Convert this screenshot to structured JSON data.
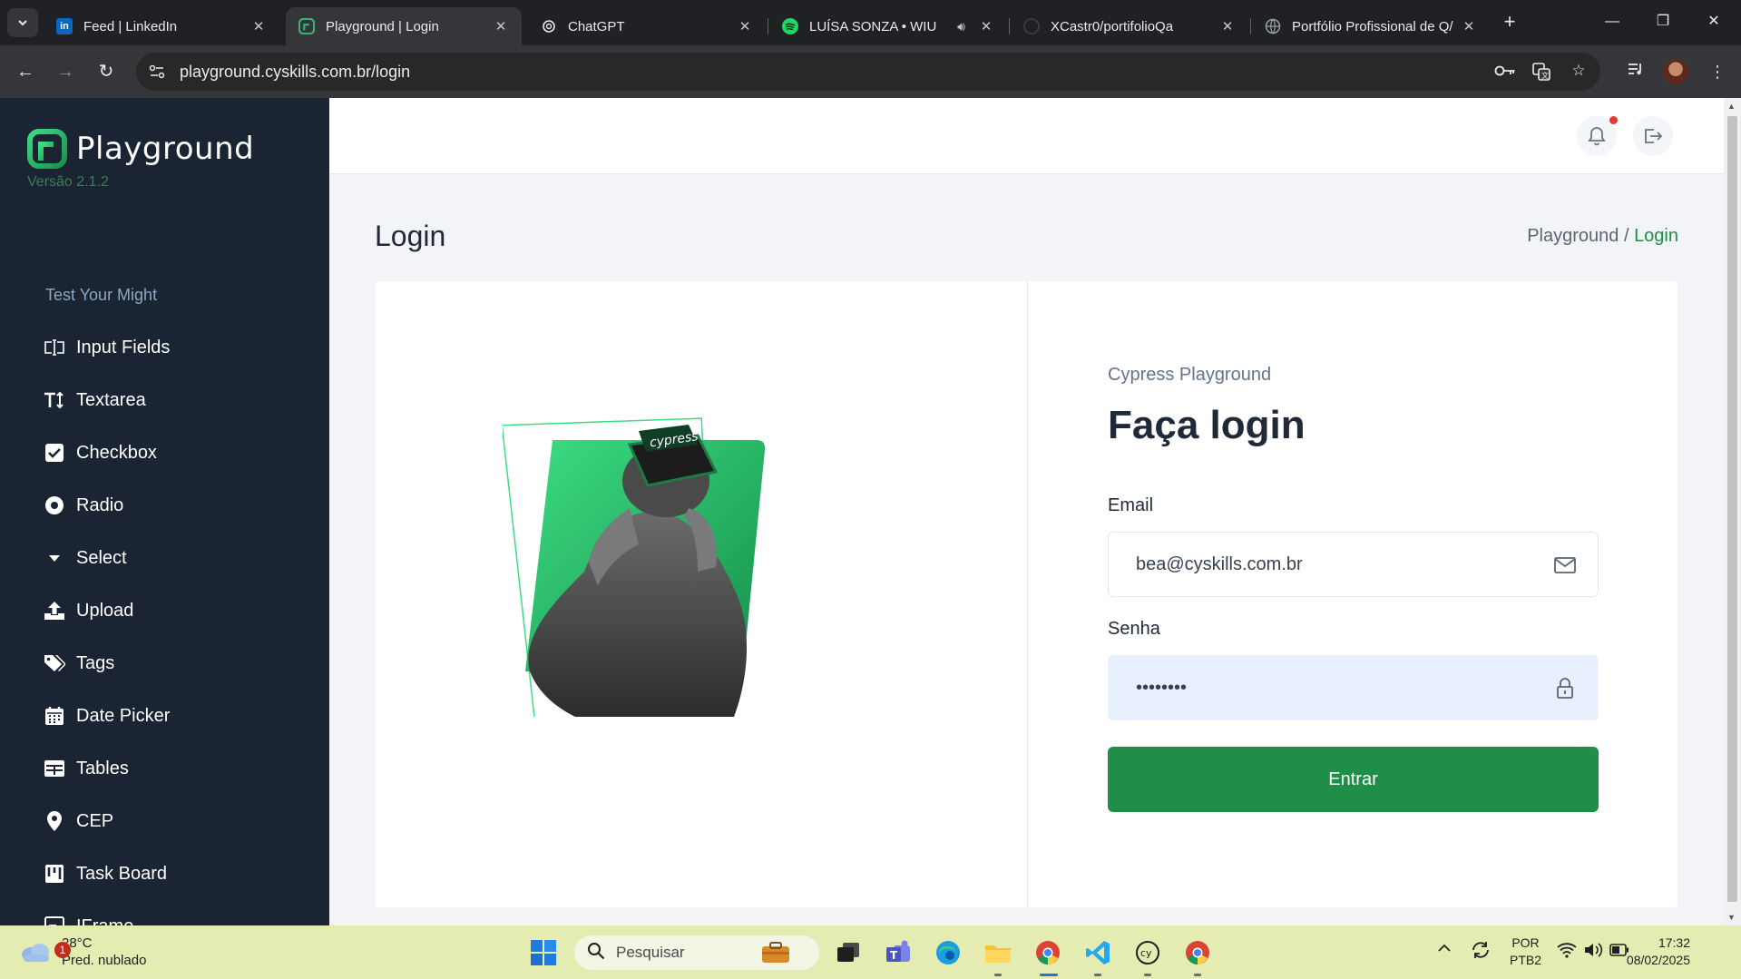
{
  "browser": {
    "tabs": [
      {
        "title": "Feed | LinkedIn",
        "icon": "linkedin-icon",
        "active": false
      },
      {
        "title": "Playground | Login",
        "icon": "playground-icon",
        "active": true
      },
      {
        "title": "ChatGPT",
        "icon": "chatgpt-icon",
        "active": false
      },
      {
        "title": "LUÍSA SONZA • WIU",
        "icon": "spotify-icon",
        "active": false
      },
      {
        "title": "XCastr0/portifolioQa",
        "icon": "github-icon",
        "active": false
      },
      {
        "title": "Portfólio Profissional de Q/",
        "icon": "globe-icon",
        "active": false
      }
    ],
    "url": "playground.cyskills.com.br/login"
  },
  "sidebar": {
    "logo_text": "Playground",
    "version": "Versão 2.1.2",
    "section_title": "Test Your Might",
    "items": [
      {
        "label": "Input Fields",
        "icon": "input-field-icon"
      },
      {
        "label": "Textarea",
        "icon": "text-height-icon"
      },
      {
        "label": "Checkbox",
        "icon": "checkbox-icon"
      },
      {
        "label": "Radio",
        "icon": "radio-icon"
      },
      {
        "label": "Select",
        "icon": "caret-down-icon"
      },
      {
        "label": "Upload",
        "icon": "upload-icon"
      },
      {
        "label": "Tags",
        "icon": "tags-icon"
      },
      {
        "label": "Date Picker",
        "icon": "calendar-icon"
      },
      {
        "label": "Tables",
        "icon": "table-icon"
      },
      {
        "label": "CEP",
        "icon": "map-pin-icon"
      },
      {
        "label": "Task Board",
        "icon": "task-board-icon"
      },
      {
        "label": "IFrame",
        "icon": "iframe-icon"
      }
    ]
  },
  "page": {
    "title": "Login",
    "breadcrumb": {
      "root": "Playground",
      "separator": "/",
      "current": "Login"
    }
  },
  "login": {
    "subtitle": "Cypress Playground",
    "heading": "Faça login",
    "email_label": "Email",
    "email_value": "bea@cyskills.com.br",
    "password_label": "Senha",
    "password_value": "••••••••",
    "submit_label": "Entrar",
    "image_badge_text": "cypress"
  },
  "taskbar": {
    "weather_temp": "28°C",
    "weather_desc": "Pred. nublado",
    "weather_badge": "1",
    "search_placeholder": "Pesquisar",
    "lang_top": "POR",
    "lang_bottom": "PTB2",
    "time": "17:32",
    "date": "08/02/2025"
  },
  "colors": {
    "brand_green": "#1f8e48",
    "sidebar_bg": "#1b2433",
    "page_bg": "#f3f4f7",
    "taskbar_bg": "#e4ecb2"
  }
}
